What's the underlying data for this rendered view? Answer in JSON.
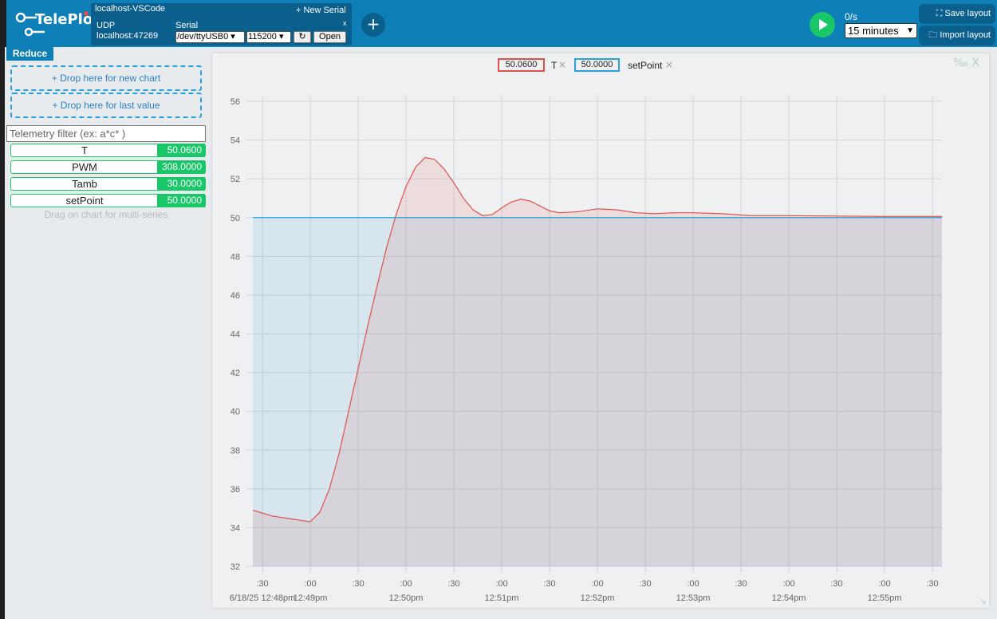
{
  "app": {
    "logo_text": "TelePlot",
    "connection_name": "localhost-VSCode",
    "new_serial": "+ New Serial",
    "udp_label": "UDP",
    "udp_address": "localhost:47269",
    "serial_label": "Serial",
    "serial_close": "x",
    "serial_port": "/dev/ttyUSB0",
    "baud_rate": "115200",
    "refresh_symbol": "↻",
    "open_label": "Open",
    "add_symbol": "+",
    "rate": "0/s",
    "window": "15 minutes",
    "save_layout": "Save layout",
    "import_layout": "Import layout"
  },
  "left": {
    "reduce_label": "Reduce",
    "drop_new_chart": "+ Drop here for new chart",
    "drop_last_value": "+ Drop here for last value",
    "filter_placeholder": "Telemetry filter (ex: a*c* )",
    "telemetries": [
      {
        "name": "T",
        "value": "50.0600"
      },
      {
        "name": "PWM",
        "value": "308.0000"
      },
      {
        "name": "Tamb",
        "value": "30.0000"
      },
      {
        "name": "setPoint",
        "value": "50.0000"
      }
    ],
    "hint": "Drag on chart for multi-series"
  },
  "chart": {
    "legend": [
      {
        "value": "50.0600",
        "name": "T",
        "color": "#e0504a"
      },
      {
        "value": "50.0000",
        "name": "setPoint",
        "color": "#2b9fd9"
      }
    ],
    "remove_symbol": "×",
    "tools": "‰ X",
    "resize_symbol": "↘"
  },
  "chart_data": {
    "type": "area",
    "ylim": [
      32,
      56
    ],
    "yticks": [
      32,
      34,
      36,
      38,
      40,
      42,
      44,
      46,
      48,
      50,
      52,
      54,
      56
    ],
    "xtick_labels": [
      ":30",
      ":00",
      ":30",
      ":00",
      ":30",
      ":00",
      ":30",
      ":00",
      ":30",
      ":00",
      ":30",
      ":00",
      ":30",
      ":00",
      ":30"
    ],
    "xtick_minutes": [
      -0.5,
      0,
      0.5,
      1,
      1.5,
      2,
      2.5,
      3,
      3.5,
      4,
      4.5,
      5,
      5.5,
      6,
      6.5
    ],
    "time_labels": [
      {
        "m": -0.5,
        "text": "6/18/25 12:48pm"
      },
      {
        "m": 0,
        "text": "12:49pm"
      },
      {
        "m": 1,
        "text": "12:50pm"
      },
      {
        "m": 2,
        "text": "12:51pm"
      },
      {
        "m": 3,
        "text": "12:52pm"
      },
      {
        "m": 4,
        "text": "12:53pm"
      },
      {
        "m": 5,
        "text": "12:54pm"
      },
      {
        "m": 6,
        "text": "12:55pm"
      }
    ],
    "x_range_minutes_after_1249pm": [
      -0.6,
      6.6
    ],
    "grid": true,
    "series": [
      {
        "name": "T",
        "color": "#e0504a",
        "points": [
          [
            -0.6,
            34.9
          ],
          [
            -0.4,
            34.6
          ],
          [
            -0.2,
            34.45
          ],
          [
            0.0,
            34.3
          ],
          [
            0.1,
            34.8
          ],
          [
            0.2,
            36.0
          ],
          [
            0.3,
            37.8
          ],
          [
            0.4,
            40.0
          ],
          [
            0.5,
            42.2
          ],
          [
            0.6,
            44.4
          ],
          [
            0.7,
            46.5
          ],
          [
            0.8,
            48.5
          ],
          [
            0.9,
            50.2
          ],
          [
            1.0,
            51.6
          ],
          [
            1.1,
            52.6
          ],
          [
            1.2,
            53.1
          ],
          [
            1.3,
            53.0
          ],
          [
            1.4,
            52.5
          ],
          [
            1.5,
            51.8
          ],
          [
            1.6,
            51.0
          ],
          [
            1.7,
            50.4
          ],
          [
            1.8,
            50.1
          ],
          [
            1.9,
            50.15
          ],
          [
            2.0,
            50.5
          ],
          [
            2.1,
            50.8
          ],
          [
            2.2,
            50.95
          ],
          [
            2.3,
            50.85
          ],
          [
            2.4,
            50.6
          ],
          [
            2.5,
            50.35
          ],
          [
            2.6,
            50.25
          ],
          [
            2.8,
            50.3
          ],
          [
            3.0,
            50.45
          ],
          [
            3.2,
            50.4
          ],
          [
            3.4,
            50.25
          ],
          [
            3.6,
            50.2
          ],
          [
            3.8,
            50.25
          ],
          [
            4.0,
            50.25
          ],
          [
            4.3,
            50.2
          ],
          [
            4.6,
            50.1
          ],
          [
            5.0,
            50.1
          ],
          [
            5.5,
            50.08
          ],
          [
            6.0,
            50.06
          ],
          [
            6.6,
            50.06
          ]
        ]
      },
      {
        "name": "setPoint",
        "color": "#2b9fd9",
        "points": [
          [
            -0.6,
            50.0
          ],
          [
            6.6,
            50.0
          ]
        ]
      }
    ]
  }
}
